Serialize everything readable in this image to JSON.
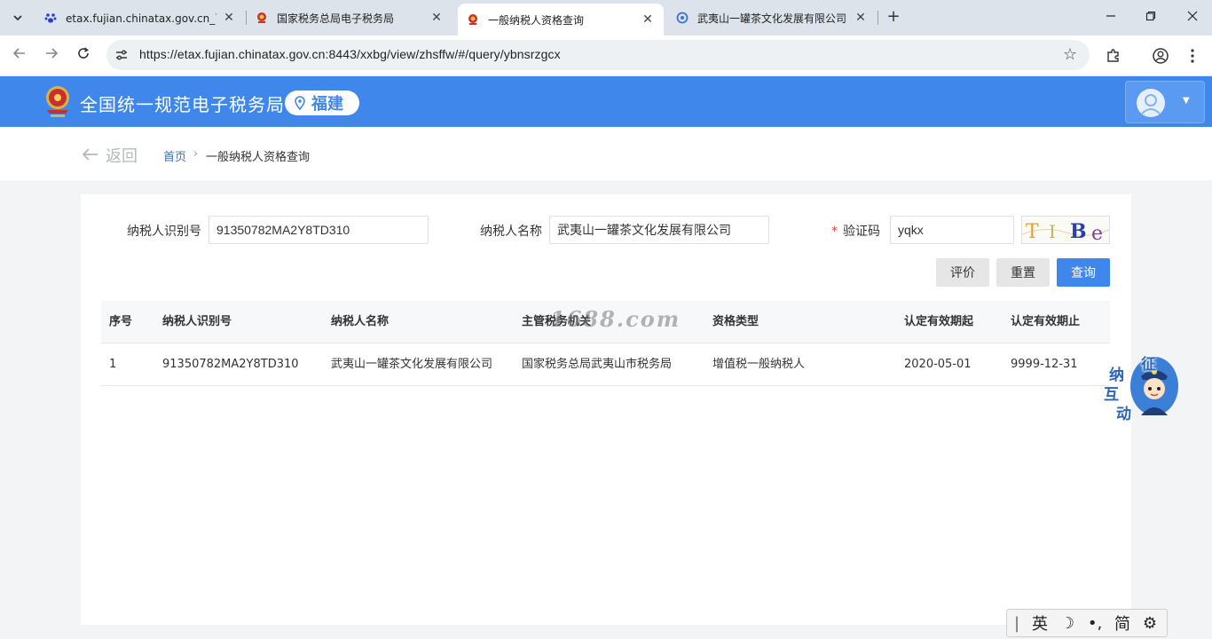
{
  "browser": {
    "tabs": [
      {
        "title": "etax.fujian.chinatax.gov.cn_百",
        "active": false,
        "favicon": "baidu-paw-icon"
      },
      {
        "title": "国家税务总局电子税务局",
        "active": false,
        "favicon": "tax-emblem-icon"
      },
      {
        "title": "一般纳税人资格查询",
        "active": true,
        "favicon": "tax-emblem-icon"
      },
      {
        "title": "武夷山一罐茶文化发展有限公司",
        "active": false,
        "favicon": "web-globe-icon"
      }
    ],
    "new_tab": "+",
    "url": "https://etax.fujian.chinatax.gov.cn:8443/xxbg/view/zhsffw/#/query/ybnsrzgcx"
  },
  "header": {
    "site_title": "全国统一规范电子税务局",
    "region": "福建"
  },
  "breadcrumb": {
    "back_label": "返回",
    "home": "首页",
    "separator": "›",
    "current": "一般纳税人资格查询"
  },
  "form": {
    "taxpayer_id_label": "纳税人识别号",
    "taxpayer_id_value": "91350782MA2Y8TD310",
    "taxpayer_name_label": "纳税人名称",
    "taxpayer_name_value": "武夷山一罐茶文化发展有限公司",
    "captcha_label": "验证码",
    "captcha_required_mark": "*",
    "captcha_value": "yqkx",
    "captcha_image_text": [
      "T",
      "I",
      "B",
      "e"
    ]
  },
  "buttons": {
    "evaluate": "评价",
    "reset": "重置",
    "query": "查询"
  },
  "table": {
    "columns": [
      "序号",
      "纳税人识别号",
      "纳税人名称",
      "主管税务机关",
      "资格类型",
      "认定有效期起",
      "认定有效期止"
    ],
    "rows": [
      [
        "1",
        "91350782MA2Y8TD310",
        "武夷山一罐茶文化发展有限公司",
        "国家税务总局武夷山市税务局",
        "增值税一般纳税人",
        "2020-05-01",
        "9999-12-31"
      ]
    ]
  },
  "watermark": "1688.com",
  "assistant": {
    "chars": [
      "征",
      "纳",
      "互",
      "动"
    ]
  },
  "ime": {
    "cursor": "|",
    "lang": "英",
    "mode": "☽",
    "punct": "•,",
    "script": "简",
    "settings": "⚙"
  },
  "colors": {
    "brand_blue": "#3f87ea",
    "link_blue": "#3f6fb8",
    "required_red": "#e0443e"
  }
}
